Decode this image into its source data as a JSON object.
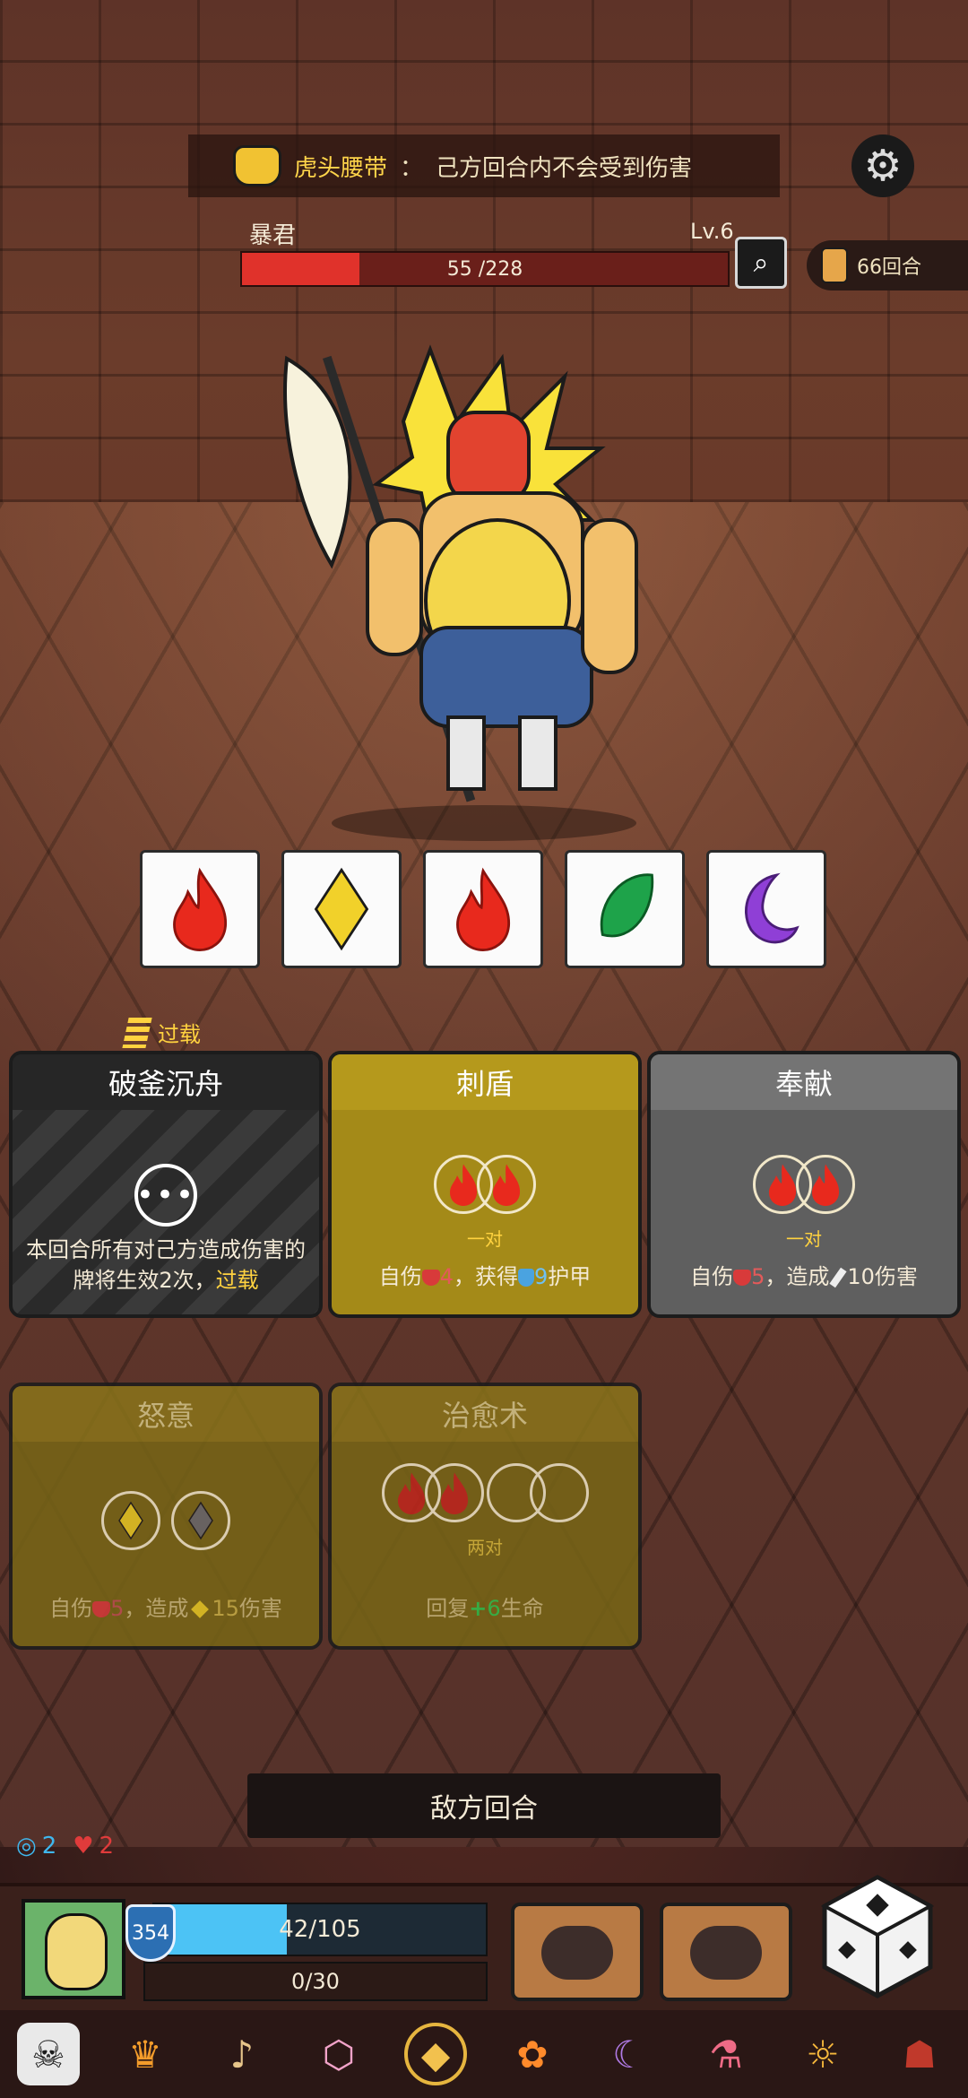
{
  "banner": {
    "relic_name": "虎头腰带",
    "separator": "：",
    "relic_text": "己方回合内不会受到伤害"
  },
  "boss": {
    "name": "暴君",
    "level": "Lv.6",
    "hp_text": "55 /228",
    "hp_current": 55,
    "hp_max": 228
  },
  "turn_counter": "66回合",
  "dice_row": [
    "fire-icon",
    "diamond-icon",
    "fire-icon",
    "leaf-icon",
    "moon-icon"
  ],
  "overload_tag": "过载",
  "cards": {
    "card1": {
      "title": "破釜沉舟",
      "dots": "•••",
      "desc": "本回合所有对己方造成伤害的牌将生效2次，",
      "desc_hl": "过载"
    },
    "card2": {
      "title": "刺盾",
      "sub": "一对",
      "desc_a": "自伤",
      "desc_heart_val": "4",
      "desc_b": "，获得",
      "desc_shield_val": "9",
      "desc_c": "护甲"
    },
    "card3": {
      "title": "奉献",
      "sub": "一对",
      "desc_a": "自伤",
      "desc_heart_val": "5",
      "desc_b": "，造成",
      "desc_val": "10",
      "desc_c": "伤害"
    },
    "card4": {
      "title": "怒意",
      "desc_a": "自伤",
      "desc_heart_val": "5",
      "desc_b": "，造成",
      "desc_val": "15",
      "desc_c": "伤害"
    },
    "card5": {
      "title": "治愈术",
      "sub": "两对",
      "desc_a": "回复",
      "desc_val": "6",
      "desc_c": "生命"
    }
  },
  "enemy_turn_label": "敌方回合",
  "status": {
    "shield_count": "2",
    "broken_count": "2"
  },
  "player": {
    "armor": "354",
    "hp_text": "42/105",
    "hp_current": 42,
    "hp_max": 105,
    "mp_text": "0/30"
  },
  "dock": [
    "skull-helmet-icon",
    "crown-icon",
    "horn-icon",
    "d20-icon",
    "emblem-icon",
    "fire-flower-icon",
    "boot-icon",
    "potion-icon",
    "mask-icon",
    "hood-icon"
  ],
  "colors": {
    "boss_hp": "#e0322b",
    "player_hp": "#4cc3f5",
    "highlight": "#ffd23f"
  }
}
